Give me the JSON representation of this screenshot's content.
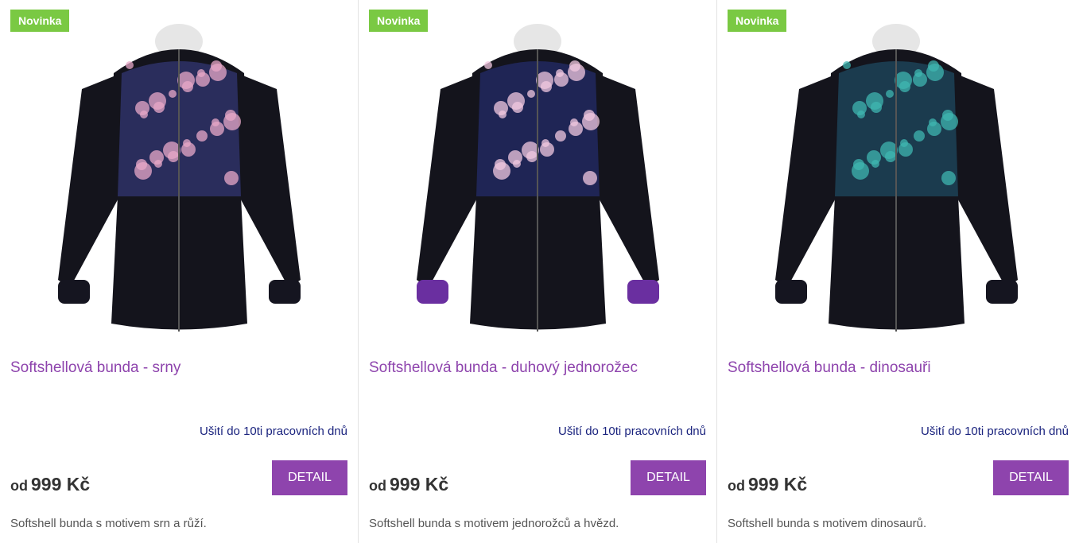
{
  "products": [
    {
      "badge": "Novinka",
      "title": "Softshellová bunda - srny",
      "delivery": "Ušití do 10ti pracovních dnů",
      "price_prefix": "od",
      "price": "999 Kč",
      "button": "DETAIL",
      "description": "Softshell bunda s motivem srn a růží.",
      "image": "jacket-deer-roses",
      "pattern_color": "#2a2d5c",
      "accent_color": "#e8a8c8",
      "cuff_color": "#151520"
    },
    {
      "badge": "Novinka",
      "title": "Softshellová bunda - duhový jednorožec",
      "delivery": "Ušití do 10ti pracovních dnů",
      "price_prefix": "od",
      "price": "999 Kč",
      "button": "DETAIL",
      "description": "Softshell bunda s motivem jednorožců a hvězd.",
      "image": "jacket-rainbow-unicorn",
      "pattern_color": "#1f2555",
      "accent_color": "#f2c8e0",
      "cuff_color": "#6a2fa0"
    },
    {
      "badge": "Novinka",
      "title": "Softshellová bunda - dinosauři",
      "delivery": "Ušití do 10ti pracovních dnů",
      "price_prefix": "od",
      "price": "999 Kč",
      "button": "DETAIL",
      "description": "Softshell bunda s motivem dinosaurů.",
      "image": "jacket-dinosaurs",
      "pattern_color": "#1b3b4e",
      "accent_color": "#3fb5b0",
      "cuff_color": "#151520"
    }
  ],
  "colors": {
    "badge": "#7ac943",
    "title": "#8e44ad",
    "button": "#8e44ad",
    "delivery": "#1a237e"
  }
}
